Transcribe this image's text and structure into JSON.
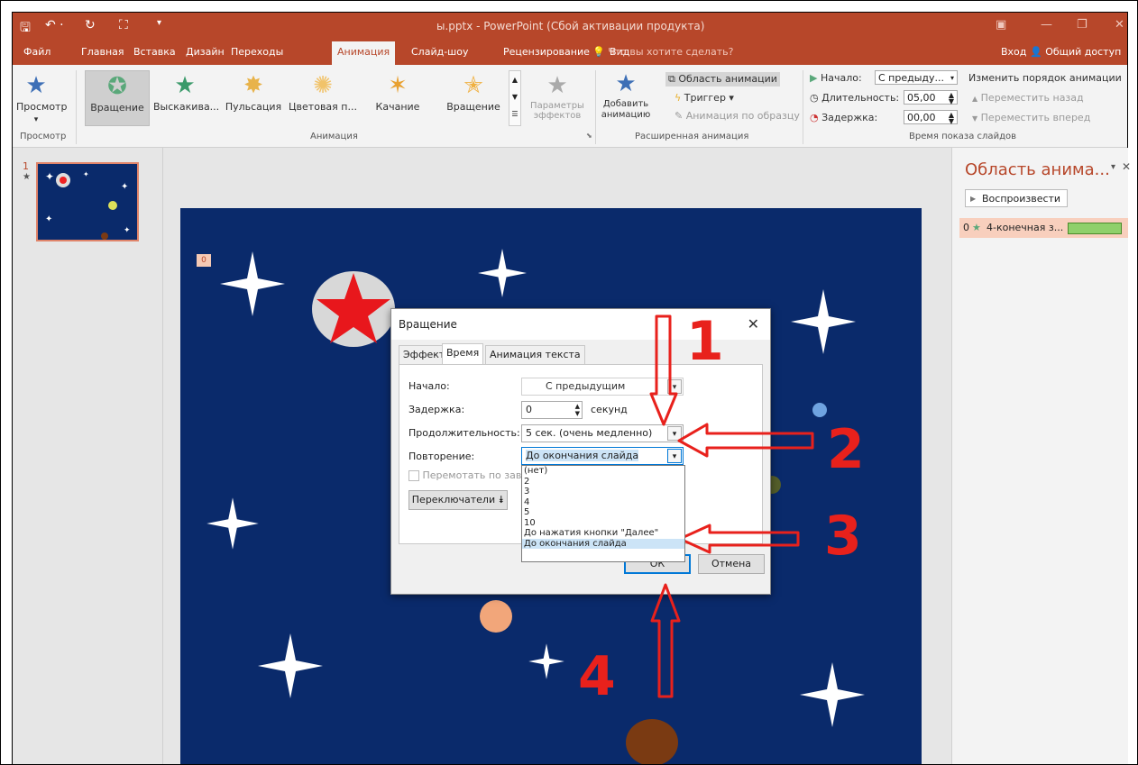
{
  "titlebar": {
    "title": "ы.pptx - PowerPoint (Сбой активации продукта)",
    "save_icon": "save-icon",
    "undo_icon": "undo-icon",
    "redo_icon": "redo-icon"
  },
  "tabs": [
    {
      "label": "Файл"
    },
    {
      "label": "Главная"
    },
    {
      "label": "Вставка"
    },
    {
      "label": "Дизайн"
    },
    {
      "label": "Переходы"
    },
    {
      "label": "Анимация"
    },
    {
      "label": "Слайд-шоу"
    },
    {
      "label": "Рецензирование"
    },
    {
      "label": "Вид"
    }
  ],
  "tell_me": "Что вы хотите сделать?",
  "sign_in": "Вход",
  "share": "Общий доступ",
  "ribbon": {
    "preview_label": "Просмотр",
    "preview_group": "Просмотр",
    "gallery": [
      "Вращение",
      "Выскакива...",
      "Пульсация",
      "Цветовая п...",
      "Качание",
      "Вращение"
    ],
    "effect_options": "Параметры эффектов",
    "animation_group": "Анимация",
    "add_animation": "Добавить анимацию",
    "animation_pane": "Область анимации",
    "trigger": "Триггер",
    "animation_painter": "Анимация по образцу",
    "advanced_group": "Расширенная анимация",
    "start_label": "Начало:",
    "start_value": "С предыду...",
    "duration_label": "Длительность:",
    "duration_value": "05,00",
    "delay_label": "Задержка:",
    "delay_value": "00,00",
    "reorder_title": "Изменить порядок анимации",
    "move_earlier": "Переместить назад",
    "move_later": "Переместить вперед",
    "timing_group": "Время показа слайдов"
  },
  "thumbnail": {
    "number": "1",
    "star": "★"
  },
  "slide": {
    "anim_tag": "0"
  },
  "anim_pane": {
    "title": "Область анима...",
    "play": "Воспроизвести",
    "item_index": "0",
    "item_label": "4-конечная з..."
  },
  "dialog": {
    "title": "Вращение",
    "tabs": [
      "Эффект",
      "Время",
      "Анимация текста"
    ],
    "start_label": "Начало:",
    "start_value": "С предыдущим",
    "delay_label": "Задержка:",
    "delay_value": "0",
    "delay_unit": "секунд",
    "duration_label": "Продолжительность:",
    "duration_value": "5 сек. (очень медленно)",
    "repeat_label": "Повторение:",
    "repeat_value": "До окончания слайда",
    "rewind_label": "Перемотать по заве",
    "triggers_button": "Переключатели",
    "repeat_options": [
      "(нет)",
      "2",
      "3",
      "4",
      "5",
      "10",
      "До нажатия кнопки \"Далее\"",
      "До окончания слайда"
    ],
    "ok": "ОК",
    "cancel": "Отмена"
  },
  "annotations": [
    "1",
    "2",
    "3",
    "4"
  ],
  "colors": {
    "accent": "#b7472a",
    "slide_bg": "#0a2a6b",
    "annotation": "#e8211c",
    "selection": "#cce4f7"
  }
}
